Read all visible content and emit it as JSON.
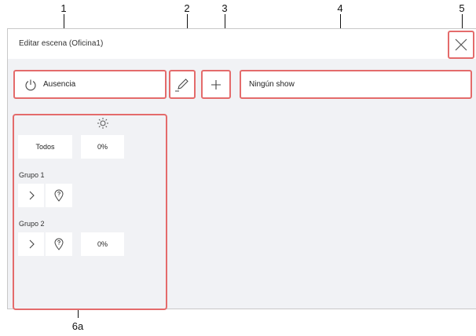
{
  "callouts": [
    "1",
    "2",
    "3",
    "4",
    "5",
    "6a"
  ],
  "dialog": {
    "title": "Editar escena (Oficina1)"
  },
  "toolbar": {
    "state_label": "Ausencia",
    "show_value": "Ningún show"
  },
  "groups": {
    "all": {
      "label": "Todos",
      "brightness": "0%"
    },
    "items": [
      {
        "label": "Grupo 1",
        "brightness": ""
      },
      {
        "label": "Grupo 2",
        "brightness": "0%"
      }
    ]
  },
  "icons": {
    "close": "close-icon",
    "power": "power-icon",
    "edit": "pencil-icon",
    "add": "plus-icon",
    "brightness": "sun-icon",
    "expand": "chevron-right-icon",
    "locate": "location-pin-icon"
  },
  "colors": {
    "highlight_border": "#e46b6b",
    "panel_background": "#f1f2f5",
    "tile_background": "#ffffff"
  }
}
